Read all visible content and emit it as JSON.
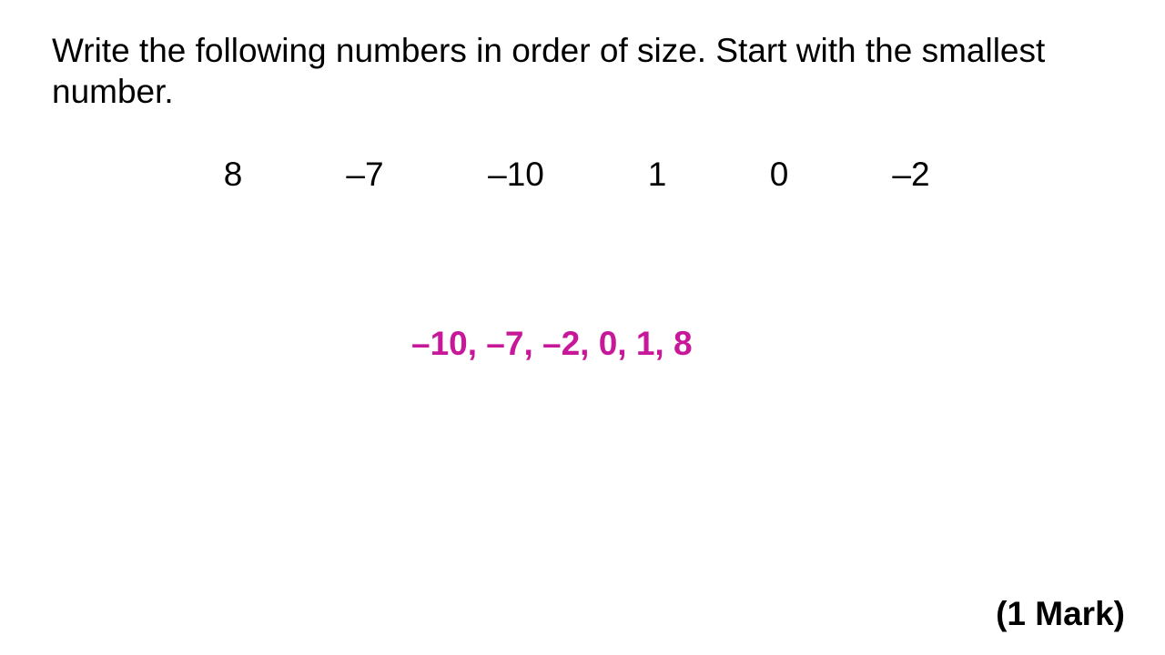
{
  "question": {
    "text": "Write the following numbers in order of size. Start with the smallest number."
  },
  "numbers": [
    "8",
    "–7",
    "–10",
    "1",
    "0",
    "–2"
  ],
  "answer": {
    "text": "–10, –7, –2, 0, 1, 8",
    "color": "#c8189a"
  },
  "marks": {
    "text": "(1 Mark)"
  }
}
